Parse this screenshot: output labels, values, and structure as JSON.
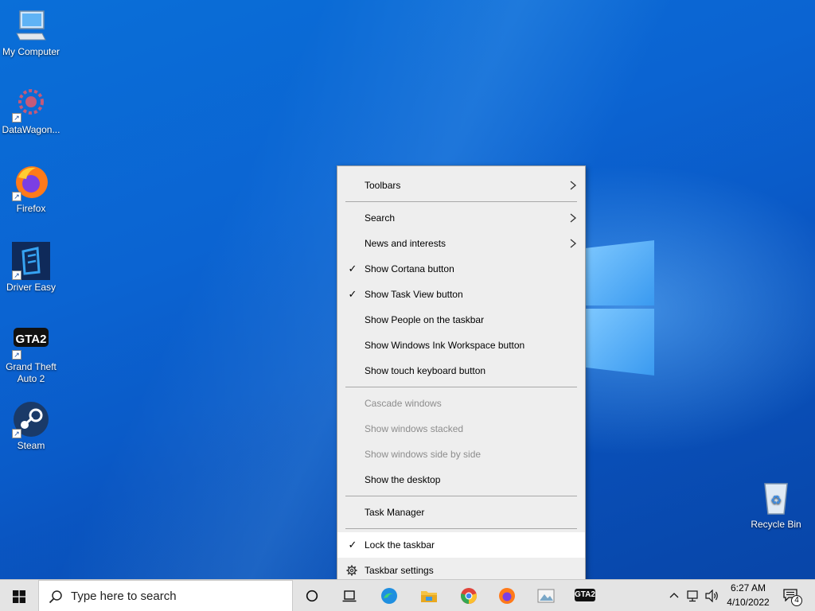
{
  "desktop": {
    "icons": [
      {
        "label": "My Computer"
      },
      {
        "label": "DataWagon..."
      },
      {
        "label": "Firefox"
      },
      {
        "label": "Driver Easy"
      },
      {
        "label": "Grand Theft Auto 2"
      },
      {
        "label": "Steam"
      },
      {
        "label": "Recycle Bin"
      }
    ]
  },
  "context_menu": {
    "items": [
      {
        "label": "Toolbars",
        "submenu": true
      },
      {
        "label": "Search",
        "submenu": true
      },
      {
        "label": "News and interests",
        "submenu": true
      },
      {
        "label": "Show Cortana button",
        "checked": true
      },
      {
        "label": "Show Task View button",
        "checked": true
      },
      {
        "label": "Show People on the taskbar"
      },
      {
        "label": "Show Windows Ink Workspace button"
      },
      {
        "label": "Show touch keyboard button"
      },
      {
        "label": "Cascade windows",
        "disabled": true
      },
      {
        "label": "Show windows stacked",
        "disabled": true
      },
      {
        "label": "Show windows side by side",
        "disabled": true
      },
      {
        "label": "Show the desktop"
      },
      {
        "label": "Task Manager"
      },
      {
        "label": "Lock the taskbar",
        "checked": true
      },
      {
        "label": "Taskbar settings",
        "icon": "gear-icon"
      }
    ],
    "check_glyph": "✓"
  },
  "taskbar": {
    "search_placeholder": "Type here to search",
    "time": "6:27 AM",
    "date": "4/10/2022",
    "notification_count": "4",
    "gta2_label": "GTA2"
  },
  "colors": {
    "menu_bg": "#eeeeee",
    "taskbar_bg": "#e4e4e4",
    "desktop_blue": "#0a64d2"
  }
}
